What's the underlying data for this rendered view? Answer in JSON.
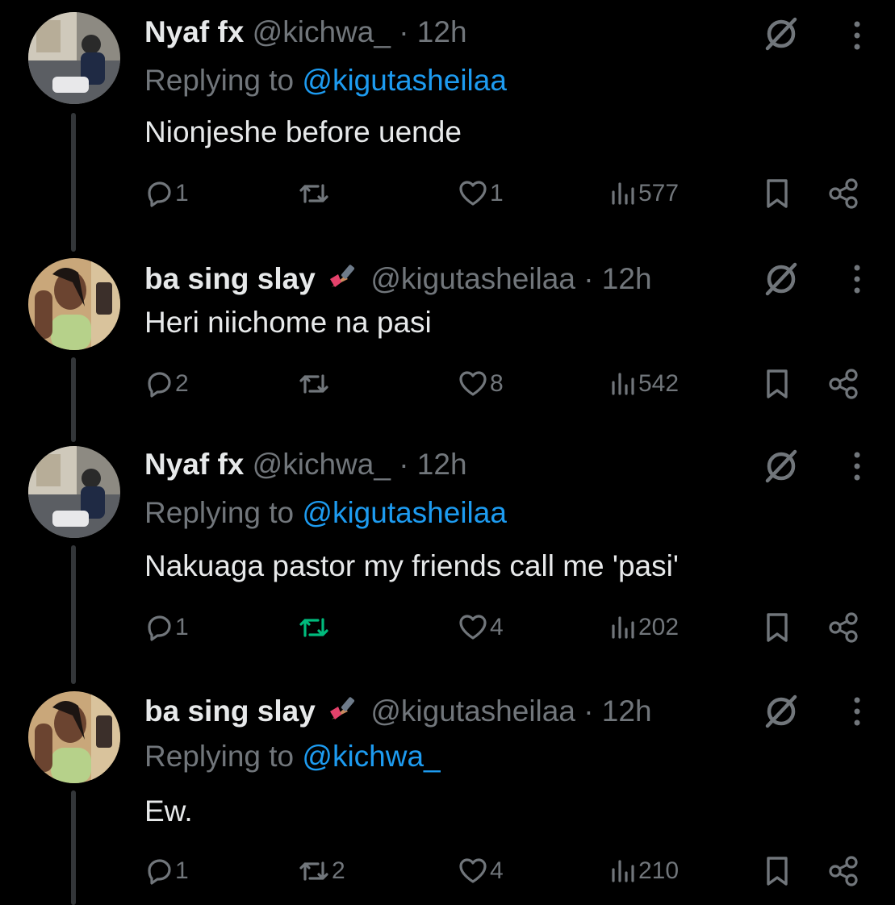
{
  "tweets": [
    {
      "name": "Nyaf fx",
      "emoji": "",
      "handle": "@kichwa_",
      "time": "· 12h",
      "replying_prefix": "Replying to",
      "replying_to": "@kigutasheilaa",
      "text": "Nionjeshe before uende",
      "replies": "1",
      "reposts": "",
      "likes": "1",
      "views": "577",
      "reposted": false
    },
    {
      "name": "ba sing slay",
      "emoji": "nail-polish-emoji",
      "handle": "@kigutasheilaa",
      "time": "· 12h",
      "replying_prefix": "",
      "replying_to": "",
      "text": "Heri niichome na pasi",
      "replies": "2",
      "reposts": "",
      "likes": "8",
      "views": "542",
      "reposted": false
    },
    {
      "name": "Nyaf fx",
      "emoji": "",
      "handle": "@kichwa_",
      "time": "· 12h",
      "replying_prefix": "Replying to",
      "replying_to": "@kigutasheilaa",
      "text": "Nakuaga pastor my friends call me 'pasi'",
      "replies": "1",
      "reposts": "",
      "likes": "4",
      "views": "202",
      "reposted": true
    },
    {
      "name": "ba sing slay",
      "emoji": "nail-polish-emoji",
      "handle": "@kigutasheilaa",
      "time": "· 12h",
      "replying_prefix": "Replying to",
      "replying_to": "@kichwa_",
      "text": "Ew.",
      "replies": "1",
      "reposts": "2",
      "likes": "4",
      "views": "210",
      "reposted": false
    }
  ],
  "colors": {
    "background": "#000000",
    "text": "#e7e9ea",
    "muted": "#71767b",
    "link": "#1d9bf0",
    "repost_active": "#00ba7c",
    "thread_line": "#333639"
  }
}
